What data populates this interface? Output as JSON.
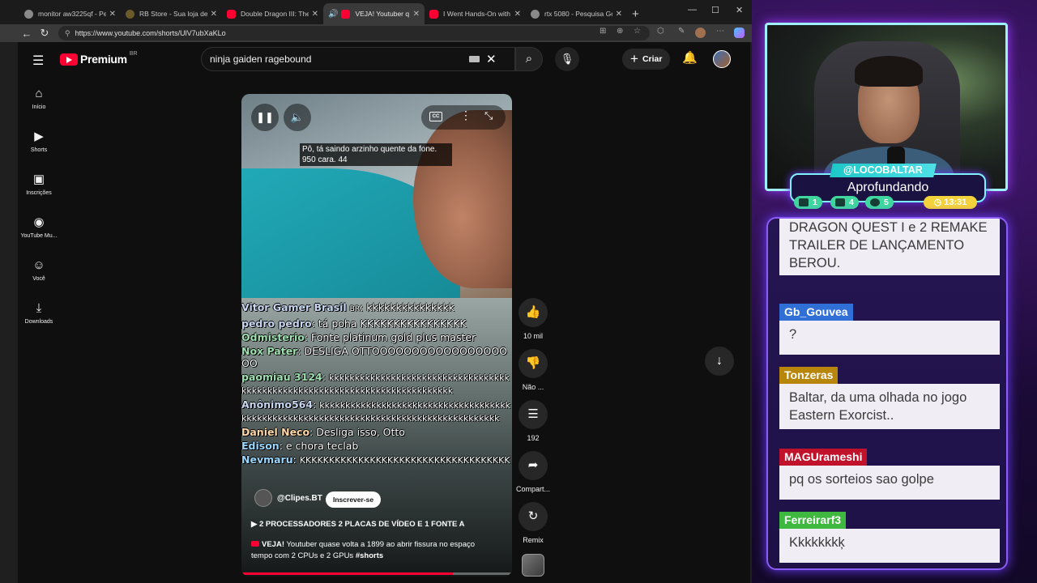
{
  "browser": {
    "tabs": [
      {
        "label": "monitor aw3225qf - Pes",
        "favicon_color": "#8a8a8a",
        "active": false
      },
      {
        "label": "RB Store - Sua loja de h",
        "favicon_color": "#6b5a2a",
        "active": false
      },
      {
        "label": "Double Dragon III: The S",
        "favicon_color": "#ff0033",
        "active": false
      },
      {
        "label": "VEJA! Youtuber q",
        "favicon_color": "#ff0033",
        "active": true
      },
      {
        "label": "I Went Hands-On with D",
        "favicon_color": "#ff0033",
        "active": false
      },
      {
        "label": "rtx 5080 - Pesquisa Goo",
        "favicon_color": "#8a8a8a",
        "active": false
      }
    ],
    "url": "https://www.youtube.com/shorts/UlV7ubXaKLo"
  },
  "youtube": {
    "logo_text": "Premium",
    "logo_region": "BR",
    "search_value": "ninja gaiden ragebound",
    "create_label": "Criar",
    "sidebar": [
      {
        "label": "Início",
        "icon": "home-icon"
      },
      {
        "label": "Shorts",
        "icon": "shorts-icon"
      },
      {
        "label": "Inscrições",
        "icon": "subscriptions-icon"
      },
      {
        "label": "YouTube Mu...",
        "icon": "youtube-music-icon"
      },
      {
        "label": "Você",
        "icon": "you-icon"
      },
      {
        "label": "Downloads",
        "icon": "download-icon"
      }
    ],
    "video": {
      "caption": "Pô, tá saindo arzinho quente da fone. 950 cara. 44",
      "chat_overlay": [
        {
          "user": "Vitor Gamer Brasil",
          "badge": "BR",
          "text": "kkkkkkkkkkkkkkk"
        },
        {
          "user": "pedro pedro",
          "text": "tá poha KKKKKKKKKKKKKKKK"
        },
        {
          "user": "Odmisterio",
          "text": "Fonte platinum gold plus master"
        },
        {
          "user": "Nox Pater",
          "text": "DESLIGA OTTOOOOOOOOOOOOOOOOOOO"
        },
        {
          "user": "paomiau 3124",
          "text": "kkkkkkkkkkkkkkkkkkkkkkkkkkkkkkkkkkkkkkkkkkkkkkkkkkkkkkkkkkkkkkkkkkkkkkkkkkkk"
        },
        {
          "user": "Anônimo564",
          "text": "kkkkkkkkkkkkkkkkkkkkkkkkkkkkkkkkkkkkkkkkkkkkkkkkkkkkkkkkkkkkkkkkkkkkkkkkkkkkkkkkkkkkkkk"
        },
        {
          "user": "Daniel Neco",
          "text": "Desliga isso, Otto"
        },
        {
          "user": "Edison",
          "text": "e chora teclab"
        },
        {
          "user": "Nevmaru",
          "text": "KKKKKKKKKKKKKKKKKKKKKKKKKKKKKKKKKKKK"
        }
      ],
      "channel": "@Clipes.BT",
      "subscribe_label": "Inscrever-se",
      "music": "2 PROCESSADORES 2 PLACAS DE VÍDEO E 1 FONTE A",
      "title_prefix": "VEJA!",
      "title_text": "Youtuber quase volta a 1899 ao abrir fissura no espaço tempo com 2 CPUs e 2 GPUs",
      "title_tag": "#shorts",
      "progress": 0.78
    },
    "actions": [
      {
        "label": "10 mil",
        "icon": "like-icon"
      },
      {
        "label": "Não ...",
        "icon": "dislike-icon"
      },
      {
        "label": "192",
        "icon": "comment-icon"
      },
      {
        "label": "Compart...",
        "icon": "share-icon"
      },
      {
        "label": "Remix",
        "icon": "remix-icon"
      }
    ]
  },
  "stream": {
    "handle": "@LOCOBALTAR",
    "status": "Aprofundando",
    "stats": [
      "1",
      "4",
      "5"
    ],
    "timer": "13:31",
    "chat": [
      {
        "user": "",
        "text": "DRAGON QUEST I e 2 REMAKE TRAILER DE LANÇAMENTO BEROU.",
        "color": "#2f6fd6"
      },
      {
        "user": "Gb_Gouvea",
        "text": "?",
        "color": "#2f6fd6"
      },
      {
        "user": "Tonzeras",
        "text": "Baltar, da uma olhada no jogo Eastern Exorcist..",
        "color": "#b8860b"
      },
      {
        "user": "MAGUrameshi",
        "text": "pq os sorteios sao golpe",
        "color": "#c0122b"
      },
      {
        "user": "Ferreirarf3",
        "text": "Kkkkkkkķ",
        "color": "#3fb83f"
      }
    ]
  }
}
